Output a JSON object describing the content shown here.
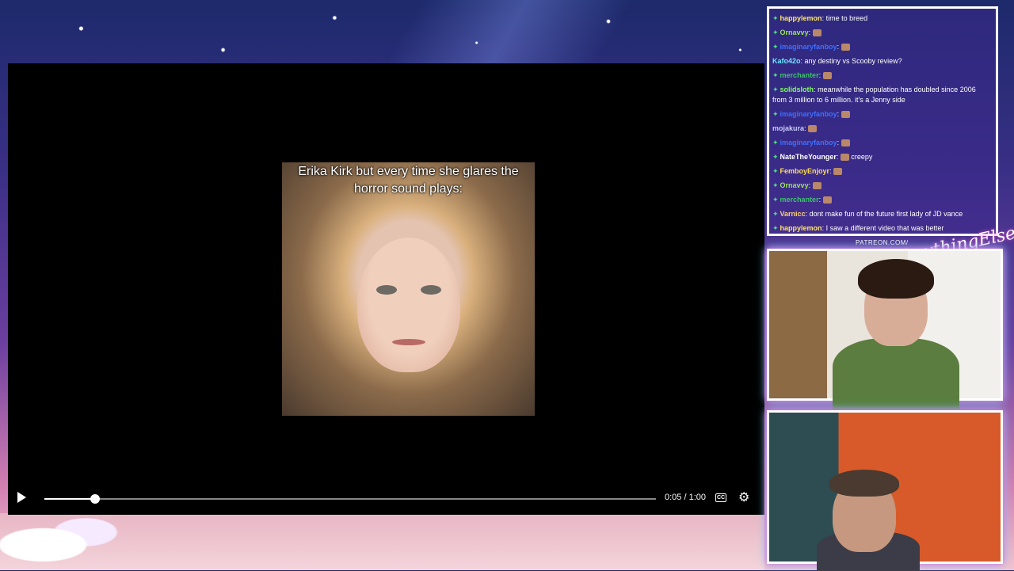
{
  "video": {
    "caption": "Erika Kirk but every time she glares the horror sound plays:",
    "current_time": "0:05",
    "duration": "1:00",
    "time_display": "0:05 / 1:00",
    "progress_fraction": 0.083,
    "cc_label": "CC"
  },
  "chat": {
    "messages": [
      {
        "user": "happylemon",
        "text": "time to breed",
        "user_color": "#ffe66b",
        "badge": true
      },
      {
        "user": "Ornavvy",
        "text": "",
        "user_color": "#9be15d",
        "badge": true,
        "emote": true
      },
      {
        "user": "imaginaryfanboy",
        "text": "",
        "user_color": "#3e6fff",
        "badge": true,
        "emote": true
      },
      {
        "user": "Kafo42o",
        "text": "any destiny vs Scooby review?",
        "user_color": "#6fe4ff",
        "badge": false
      },
      {
        "user": "merchanter",
        "text": "",
        "user_color": "#3cc36b",
        "badge": true,
        "emote": true
      },
      {
        "user": "solidsloth",
        "text": "meanwhile the population has doubled since 2006 from 3 million to 6 million. it's a Jenny side",
        "user_color": "#7cff5a",
        "badge": true
      },
      {
        "user": "imaginaryfanboy",
        "text": "",
        "user_color": "#3e6fff",
        "badge": true,
        "emote": true
      },
      {
        "user": "mojakura",
        "text": "",
        "user_color": "#c9c9ff",
        "badge": false,
        "emote": true
      },
      {
        "user": "imaginaryfanboy",
        "text": "",
        "user_color": "#3e6fff",
        "badge": true,
        "emote": true
      },
      {
        "user": "NateTheYounger",
        "text": "creepy",
        "user_color": "#ffffff",
        "badge": true,
        "emote": true
      },
      {
        "user": "FemboyEnjoyr",
        "text": "",
        "user_color": "#ffde5a",
        "badge": true,
        "emote": true
      },
      {
        "user": "Ornavvy",
        "text": "",
        "user_color": "#9be15d",
        "badge": true,
        "emote": true
      },
      {
        "user": "merchanter",
        "text": "",
        "user_color": "#3cc36b",
        "badge": true,
        "emote": true
      },
      {
        "user": "Varnicc",
        "text": "dont make fun of the future first lady of JD vance",
        "user_color": "#ffd36b",
        "badge": true
      },
      {
        "user": "happylemon",
        "text": "I saw a different video that was better",
        "user_color": "#ffe66b",
        "badge": true
      }
    ]
  },
  "overlay": {
    "patreon": "PATREON.COM/",
    "signature": "AnythingElse?"
  }
}
